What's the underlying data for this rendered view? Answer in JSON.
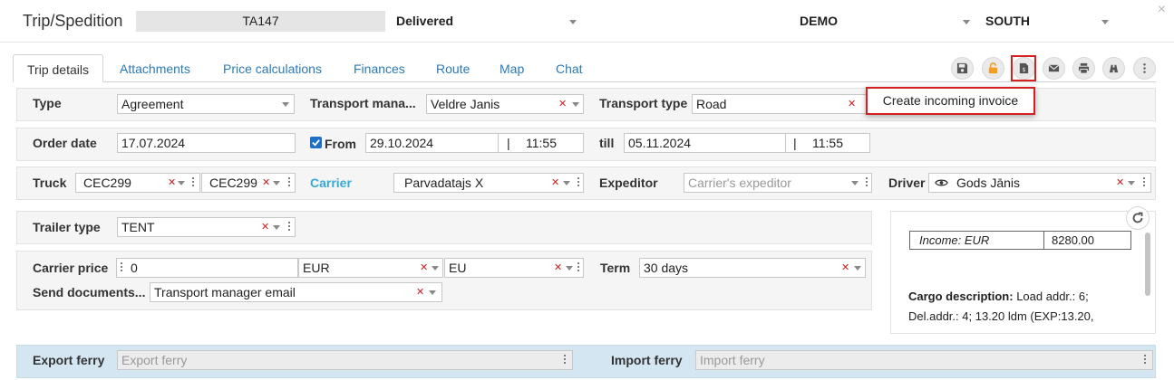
{
  "header": {
    "title": "Trip/Spedition",
    "trip_number": "TA147",
    "status": "Delivered",
    "company": "DEMO",
    "region": "SOUTH",
    "close_symbol": "×"
  },
  "tabs": [
    {
      "label": "Trip details"
    },
    {
      "label": "Attachments"
    },
    {
      "label": "Price calculations"
    },
    {
      "label": "Finances"
    },
    {
      "label": "Route"
    },
    {
      "label": "Map"
    },
    {
      "label": "Chat"
    }
  ],
  "toolbar": {
    "icons": [
      "save-icon",
      "unlock-icon",
      "invoice-icon",
      "email-icon",
      "print-icon",
      "binoculars-icon",
      "more-icon"
    ],
    "tooltip": "Create incoming invoice",
    "highlight_color": "#d42020"
  },
  "row_type": {
    "type_label": "Type",
    "type_value": "Agreement",
    "manager_label": "Transport mana...",
    "manager_value": "Veldre Janis",
    "transport_type_label": "Transport type",
    "transport_type_value": "Road"
  },
  "row_dates": {
    "order_date_label": "Order date",
    "order_date_value": "17.07.2024",
    "from_label": "From",
    "from_date": "29.10.2024",
    "from_time": "11:55",
    "till_label": "till",
    "till_date": "05.11.2024",
    "till_time": "11:55",
    "separator": "|"
  },
  "row_truck": {
    "truck_label": "Truck",
    "truck_value_1": "CEC299",
    "truck_value_2": "CEC299",
    "carrier_label": "Carrier",
    "carrier_value": "Parvadatajs X",
    "expeditor_label": "Expeditor",
    "expeditor_placeholder": "Carrier's expeditor",
    "driver_label": "Driver",
    "driver_value": "Gods Jānis"
  },
  "row_trailer": {
    "trailer_label": "Trailer type",
    "trailer_value": "TENT"
  },
  "row_price": {
    "carrier_price_label": "Carrier price",
    "price_value": "0",
    "currency": "EUR",
    "region": "EU",
    "term_label": "Term",
    "term_value": "30 days",
    "send_docs_label": "Send documents...",
    "send_docs_value": "Transport manager email"
  },
  "info": {
    "income_label": "Income: EUR",
    "income_value": "8280.00",
    "cargo_label": "Cargo description:",
    "cargo_text_1": "Load addr.: 6;",
    "cargo_text_2": "Del.addr.: 4; 13.20 ldm (EXP:13.20,"
  },
  "ferry": {
    "export_label": "Export ferry",
    "export_placeholder": "Export ferry",
    "import_label": "Import ferry",
    "import_placeholder": "Import ferry"
  },
  "colors": {
    "link": "#2a7ab8",
    "carrier_link": "#37a8d9",
    "clear_x": "#d42020",
    "checkbox": "#1e6fc6",
    "ferry_bg": "#d3e6f2",
    "unlock_icon": "#f0a020"
  }
}
